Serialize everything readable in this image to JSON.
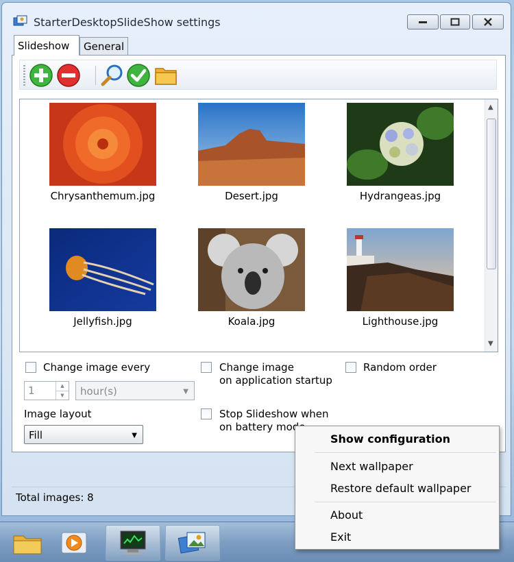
{
  "window": {
    "title": "StarterDesktopSlideShow settings",
    "buttons": [
      "minimize-icon",
      "maximize-icon",
      "close-icon"
    ]
  },
  "tabs": [
    {
      "label": "Slideshow",
      "active": true
    },
    {
      "label": "General",
      "active": false
    }
  ],
  "toolbar": {
    "icons": [
      "add-icon",
      "remove-icon",
      "search-icon",
      "ok-icon",
      "folder-icon"
    ]
  },
  "gallery": {
    "items": [
      {
        "caption": "Chrysanthemum.jpg"
      },
      {
        "caption": "Desert.jpg"
      },
      {
        "caption": "Hydrangeas.jpg"
      },
      {
        "caption": "Jellyfish.jpg"
      },
      {
        "caption": "Koala.jpg"
      },
      {
        "caption": "Lighthouse.jpg"
      }
    ]
  },
  "options": {
    "change_every_label": "Change image every",
    "change_every_checked": false,
    "interval_value": "1",
    "interval_unit": "hour(s)",
    "startup_label_line1": "Change image",
    "startup_label_line2": "on application startup",
    "startup_checked": false,
    "random_label": "Random order",
    "random_checked": false,
    "layout_label": "Image layout",
    "layout_value": "Fill",
    "battery_label_line1": "Stop Slideshow when",
    "battery_label_line2": "on battery mode",
    "battery_checked": false
  },
  "status": {
    "text": "Total images: 8"
  },
  "context_menu": {
    "items": [
      {
        "label": "Show configuration",
        "bold": true
      },
      {
        "label": "Next wallpaper"
      },
      {
        "label": "Restore default wallpaper"
      },
      {
        "label": "About"
      },
      {
        "label": "Exit"
      }
    ]
  },
  "taskbar": {
    "items": [
      "explorer-icon",
      "media-player-icon",
      "system-monitor-icon",
      "slideshow-app-icon"
    ]
  },
  "colors": {
    "window_frame": "#d4e2f2",
    "accent": "#6f8fb3",
    "taskbar": "#7e9ec2"
  }
}
